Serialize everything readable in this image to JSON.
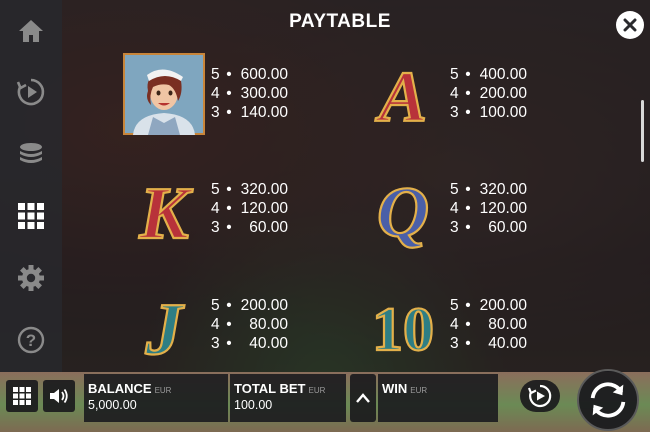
{
  "paytable": {
    "title": "PAYTABLE",
    "symbols": [
      {
        "name": "woman-symbol",
        "payouts": [
          {
            "count": "5",
            "amount": "600.00"
          },
          {
            "count": "4",
            "amount": "300.00"
          },
          {
            "count": "3",
            "amount": "140.00"
          }
        ]
      },
      {
        "name": "a-symbol",
        "letter": "A",
        "payouts": [
          {
            "count": "5",
            "amount": "400.00"
          },
          {
            "count": "4",
            "amount": "200.00"
          },
          {
            "count": "3",
            "amount": "100.00"
          }
        ]
      },
      {
        "name": "k-symbol",
        "letter": "K",
        "payouts": [
          {
            "count": "5",
            "amount": "320.00"
          },
          {
            "count": "4",
            "amount": "120.00"
          },
          {
            "count": "3",
            "amount": "60.00"
          }
        ]
      },
      {
        "name": "q-symbol",
        "letter": "Q",
        "payouts": [
          {
            "count": "5",
            "amount": "320.00"
          },
          {
            "count": "4",
            "amount": "120.00"
          },
          {
            "count": "3",
            "amount": "60.00"
          }
        ]
      },
      {
        "name": "j-symbol",
        "letter": "J",
        "payouts": [
          {
            "count": "5",
            "amount": "200.00"
          },
          {
            "count": "4",
            "amount": "80.00"
          },
          {
            "count": "3",
            "amount": "40.00"
          }
        ]
      },
      {
        "name": "ten-symbol",
        "letter": "10",
        "payouts": [
          {
            "count": "5",
            "amount": "200.00"
          },
          {
            "count": "4",
            "amount": "80.00"
          },
          {
            "count": "3",
            "amount": "40.00"
          }
        ]
      }
    ],
    "separator": "•"
  },
  "rail": {
    "icons": [
      "home-icon",
      "autoplay-icon",
      "coins-icon",
      "paytable-grid-icon",
      "gear-icon",
      "help-icon"
    ],
    "active": "paytable-grid-icon",
    "help_glyph": "?"
  },
  "footer": {
    "balance_label": "BALANCE",
    "balance_currency": "EUR",
    "balance_value": "5,000.00",
    "total_bet_label": "TOTAL BET",
    "total_bet_currency": "EUR",
    "total_bet_value": "100.00",
    "win_label": "WIN",
    "win_currency": "EUR",
    "win_value": ""
  },
  "colors": {
    "symbol_red": "#b8323a",
    "symbol_blue": "#4a5fa8",
    "symbol_teal": "#2e7e84",
    "gold": "#e3b04a",
    "text": "#ffffff"
  }
}
